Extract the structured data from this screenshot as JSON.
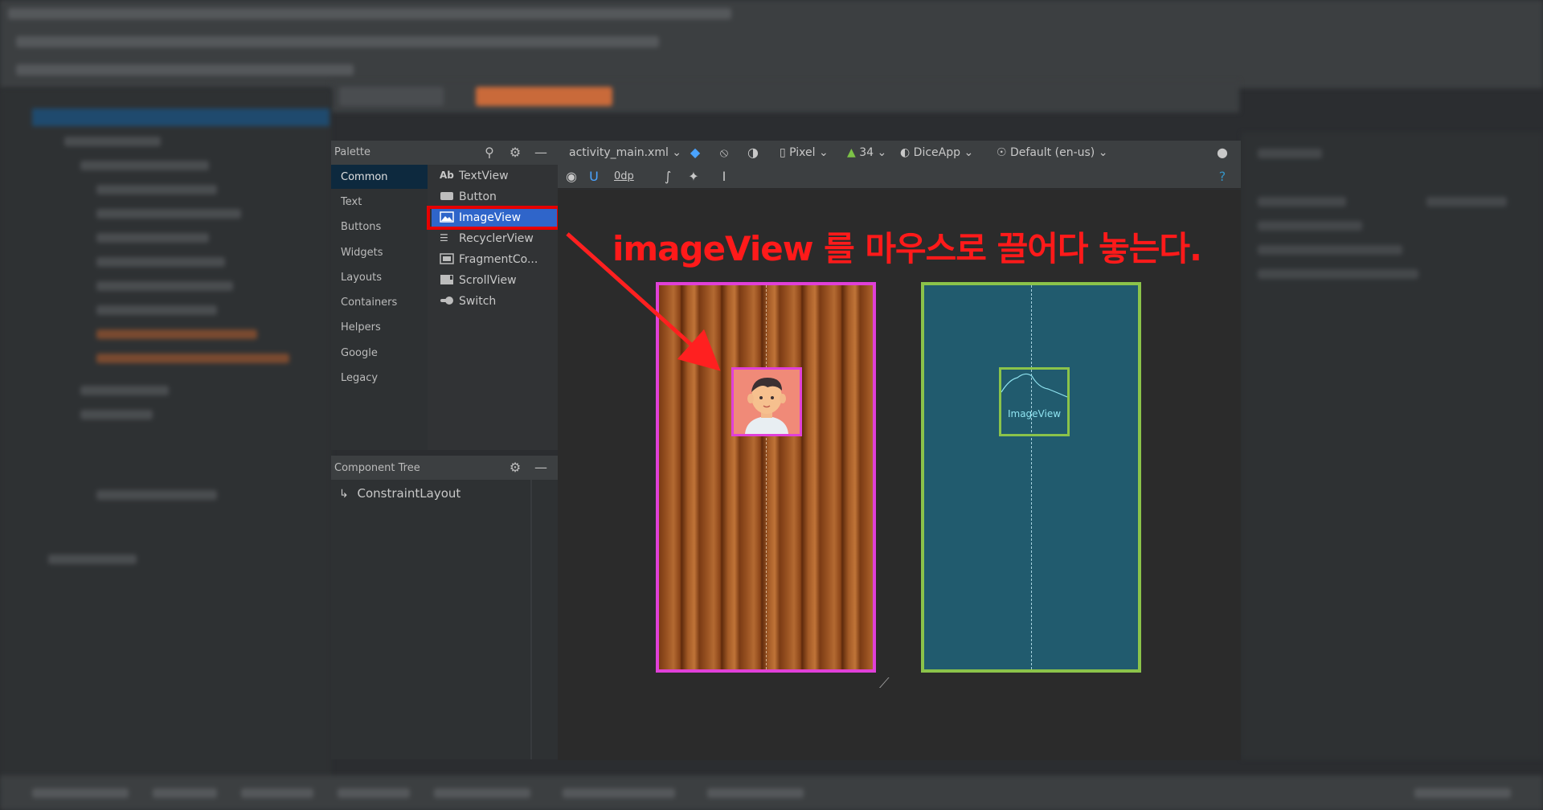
{
  "palette": {
    "title": "Palette",
    "categories": [
      {
        "label": "Common",
        "active": true
      },
      {
        "label": "Text"
      },
      {
        "label": "Buttons"
      },
      {
        "label": "Widgets"
      },
      {
        "label": "Layouts"
      },
      {
        "label": "Containers"
      },
      {
        "label": "Helpers"
      },
      {
        "label": "Google"
      },
      {
        "label": "Legacy"
      }
    ],
    "widgets": [
      {
        "label": "TextView",
        "icon": "Ab"
      },
      {
        "label": "Button",
        "icon": "button-icon"
      },
      {
        "label": "ImageView",
        "icon": "image-icon",
        "selected": true
      },
      {
        "label": "RecyclerView",
        "icon": "list-icon"
      },
      {
        "label": "FragmentCo...",
        "icon": "fragment-icon"
      },
      {
        "label": "ScrollView",
        "icon": "scroll-icon"
      },
      {
        "label": "Switch",
        "icon": "switch-icon"
      }
    ]
  },
  "component_tree": {
    "title": "Component Tree",
    "root": "ConstraintLayout"
  },
  "toolbar": {
    "file": "activity_main.xml",
    "device": "Pixel",
    "api": "34",
    "theme": "DiceApp",
    "locale": "Default (en-us)",
    "margin": "0dp"
  },
  "blueprint": {
    "image_label": "ImageView"
  },
  "annotation": "imageView 를 마우스로 끌어다 놓는다.",
  "colors": {
    "annotation": "#ff1a1a",
    "design_border": "#e040d8",
    "blueprint_border": "#8bc34a",
    "blueprint_bg": "#215b6e",
    "selected_widget": "#2f65ca"
  }
}
